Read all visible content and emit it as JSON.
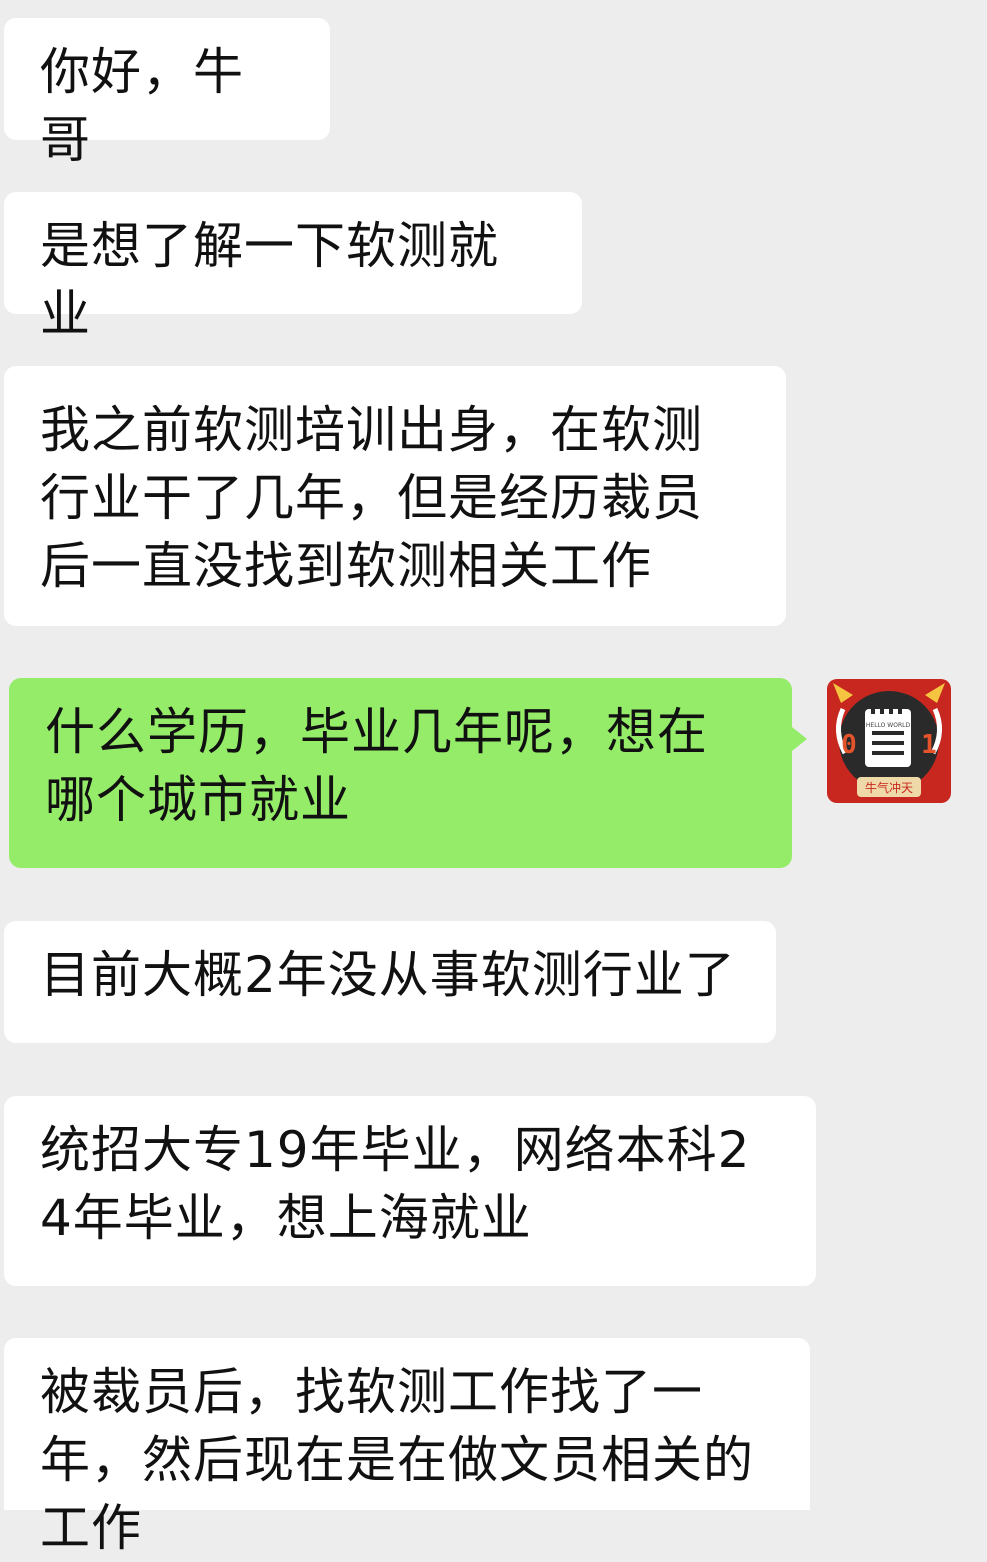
{
  "messages": [
    {
      "side": "left",
      "text": "你好，牛哥"
    },
    {
      "side": "left",
      "text": "是想了解一下软测就业"
    },
    {
      "side": "left",
      "text": "我之前软测培训出身，在软测行业干了几年，但是经历裁员后一直没找到软测相关工作"
    },
    {
      "side": "right",
      "text": "什么学历，毕业几年呢，想在哪个城市就业"
    },
    {
      "side": "left",
      "text": "目前大概2年没从事软测行业了"
    },
    {
      "side": "left",
      "text": "统招大专19年毕业，网络本科24年毕业，想上海就业"
    },
    {
      "side": "left",
      "text": "被裁员后，找软测工作找了一年，然后现在是在做文员相关的工作"
    }
  ],
  "avatar": {
    "icon": "notepad-icon",
    "left_digit": "0",
    "right_digit": "1",
    "notepad_text": "HELLO WORLD",
    "banner_text": "牛气冲天"
  },
  "colors": {
    "background": "#ededed",
    "incoming_bubble": "#ffffff",
    "outgoing_bubble": "#95ec69",
    "text": "#111111",
    "avatar_bg": "#c7271f"
  }
}
